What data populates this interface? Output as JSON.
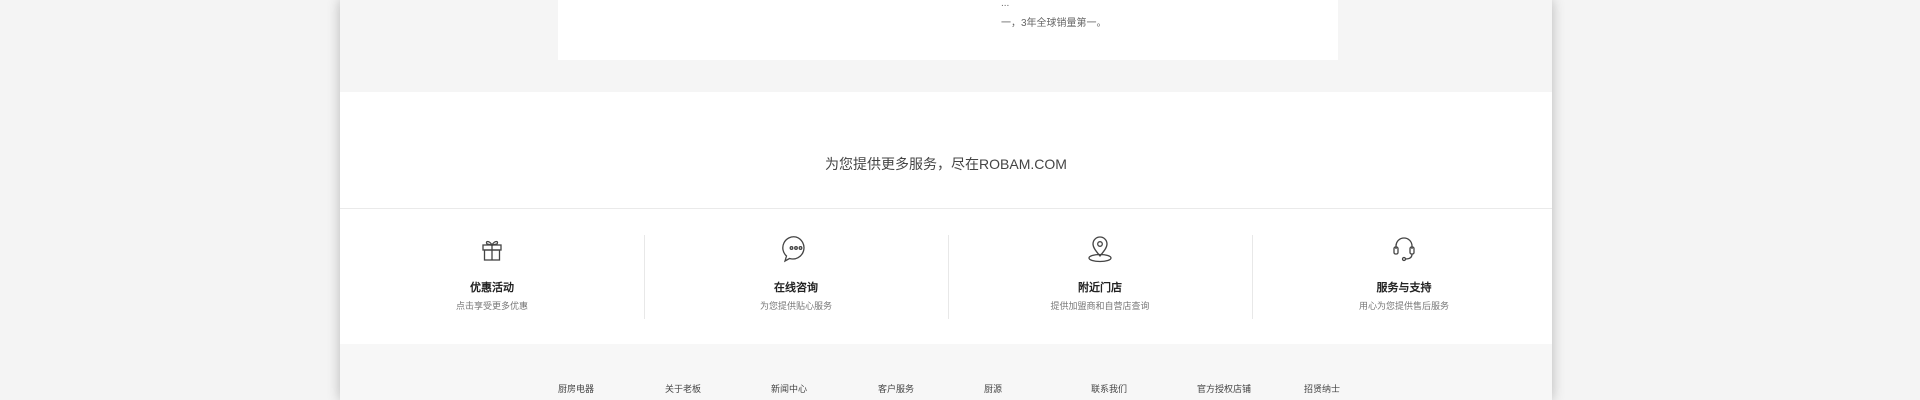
{
  "content": {
    "text_lines": [
      "...",
      "一，3年全球销量第一。"
    ]
  },
  "services": {
    "heading": "为您提供更多服务，尽在ROBAM.COM",
    "items": [
      {
        "icon": "gift-icon",
        "title": "优惠活动",
        "desc": "点击享受更多优惠"
      },
      {
        "icon": "chat-bubble-icon",
        "title": "在线咨询",
        "desc": "为您提供贴心服务"
      },
      {
        "icon": "location-pin-icon",
        "title": "附近门店",
        "desc": "提供加盟商和自营店查询"
      },
      {
        "icon": "headset-icon",
        "title": "服务与支持",
        "desc": "用心为您提供售后服务"
      }
    ]
  },
  "footer": {
    "links": [
      "厨房电器",
      "关于老板",
      "新闻中心",
      "客户服务",
      "厨源",
      "联系我们",
      "官方授权店铺",
      "招贤纳士"
    ]
  }
}
